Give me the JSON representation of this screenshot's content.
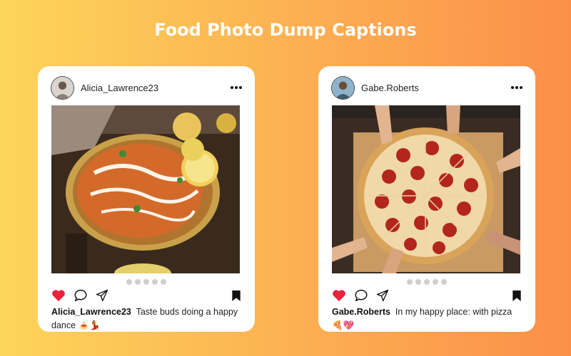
{
  "page": {
    "title": "Food Photo Dump Captions"
  },
  "posts": [
    {
      "username": "Alicia_Lawrence23",
      "caption_user": "Alicia_Lawrence23",
      "caption_text": "Taste buds doing a happy dance 🍝💃",
      "photo": "curry dish in bowl with lemon slices",
      "carousel_count": 5
    },
    {
      "username": "Gabe.Roberts",
      "caption_user": "Gabe.Roberts",
      "caption_text": "In my happy place: with pizza 🍕💖",
      "photo": "pepperoni pizza with hands reaching for slices",
      "carousel_count": 5
    }
  ],
  "colors": {
    "like": "#e8233b",
    "icon": "#111111",
    "carousel_dot": "#cfcfcf"
  },
  "icons": [
    "heart-icon",
    "comment-icon",
    "share-icon",
    "bookmark-icon",
    "more-icon"
  ]
}
